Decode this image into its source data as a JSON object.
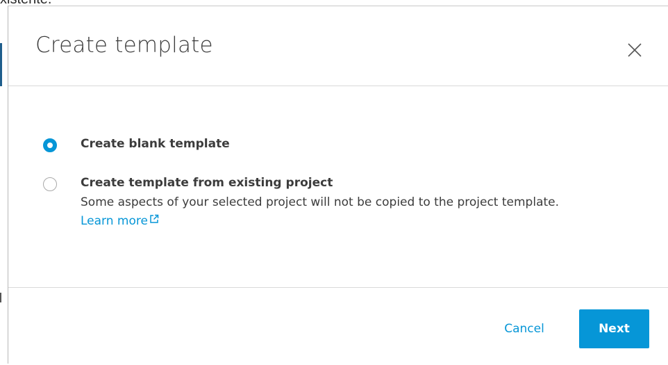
{
  "backdrop": {
    "text": "xistente."
  },
  "dialog": {
    "title": "Create template",
    "close_icon": "close-icon",
    "options": [
      {
        "label": "Create blank template",
        "selected": true
      },
      {
        "label": "Create template from existing project",
        "description": "Some aspects of your selected project will not be copied to the project template.",
        "link_text": "Learn more",
        "link_icon": "external-link-icon",
        "selected": false
      }
    ],
    "cancel_label": "Cancel",
    "next_label": "Next"
  },
  "colors": {
    "accent": "#0696d7",
    "text": "#3c3c3c",
    "divider": "#d9d9d9"
  }
}
